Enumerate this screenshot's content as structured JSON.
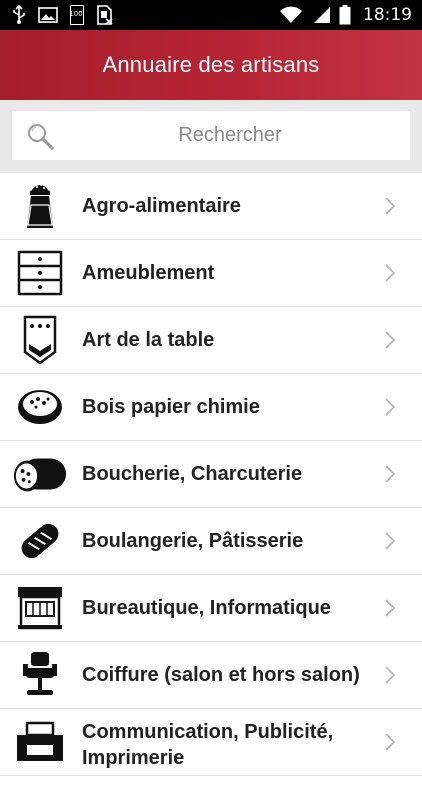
{
  "status_bar": {
    "time": "18:19",
    "icons": [
      "usb-icon",
      "image-icon",
      "battery-100-icon",
      "sim-icon",
      "wifi-icon",
      "signal-icon",
      "battery-icon"
    ],
    "battery_level_text": "100"
  },
  "header": {
    "title": "Annuaire des artisans"
  },
  "search": {
    "placeholder": "Rechercher"
  },
  "categories": [
    {
      "label": "Agro-alimentaire",
      "icon": "salt-shaker-icon"
    },
    {
      "label": "Ameublement",
      "icon": "dresser-icon"
    },
    {
      "label": "Art de la table",
      "icon": "tablecloth-icon"
    },
    {
      "label": "Bois papier chimie",
      "icon": "bowl-icon"
    },
    {
      "label": "Boucherie, Charcuterie",
      "icon": "sausage-icon"
    },
    {
      "label": "Boulangerie, Pâtisserie",
      "icon": "bread-icon"
    },
    {
      "label": "Bureautique, Informatique",
      "icon": "shop-icon"
    },
    {
      "label": "Coiffure (salon et hors salon)",
      "icon": "barber-chair-icon"
    },
    {
      "label": "Communication, Publicité, Imprimerie",
      "icon": "printer-icon"
    }
  ],
  "colors": {
    "appbar": "#b02231",
    "text": "#222222",
    "chevron": "#b3b3b3"
  }
}
